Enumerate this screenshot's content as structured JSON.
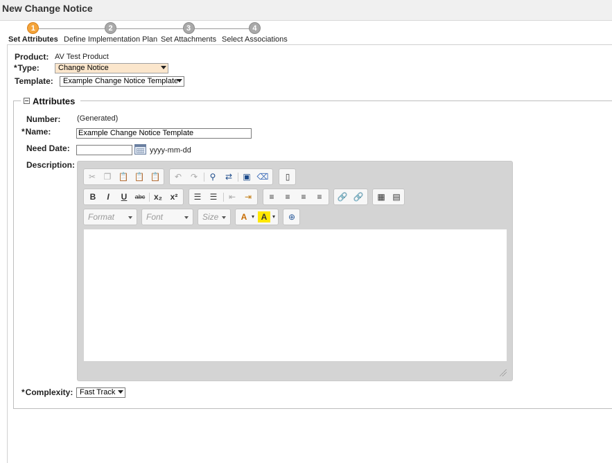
{
  "header": {
    "title": "New Change Notice"
  },
  "wizard": {
    "steps": [
      {
        "num": "1",
        "label": "Set Attributes"
      },
      {
        "num": "2",
        "label": "Define Implementation Plan"
      },
      {
        "num": "3",
        "label": "Set Attachments"
      },
      {
        "num": "4",
        "label": "Select Associations"
      }
    ],
    "active_step": 1
  },
  "form": {
    "required_marker": "*",
    "product_label": "Product:",
    "product_value": "AV Test Product",
    "type_label": "Type:",
    "type_value": "Change Notice",
    "template_label": "Template:",
    "template_value": "Example Change Notice Template",
    "attributes_legend": "Attributes",
    "number_label": "Number:",
    "number_value": "(Generated)",
    "name_label": "Name:",
    "name_value": "Example Change Notice Template",
    "need_date_label": "Need Date:",
    "need_date_value": "",
    "need_date_hint": "yyyy-mm-dd",
    "description_label": "Description:",
    "complexity_label": "Complexity:",
    "complexity_value": "Fast Track"
  },
  "editor": {
    "format_placeholder": "Format",
    "font_placeholder": "Font",
    "size_placeholder": "Size",
    "content": ""
  },
  "colors": {
    "active_step": "#f4a43a",
    "inactive_step": "#a9a9a9",
    "type_highlight": "#fbe6cc",
    "toolbar_bg": "#d4d4d4"
  }
}
